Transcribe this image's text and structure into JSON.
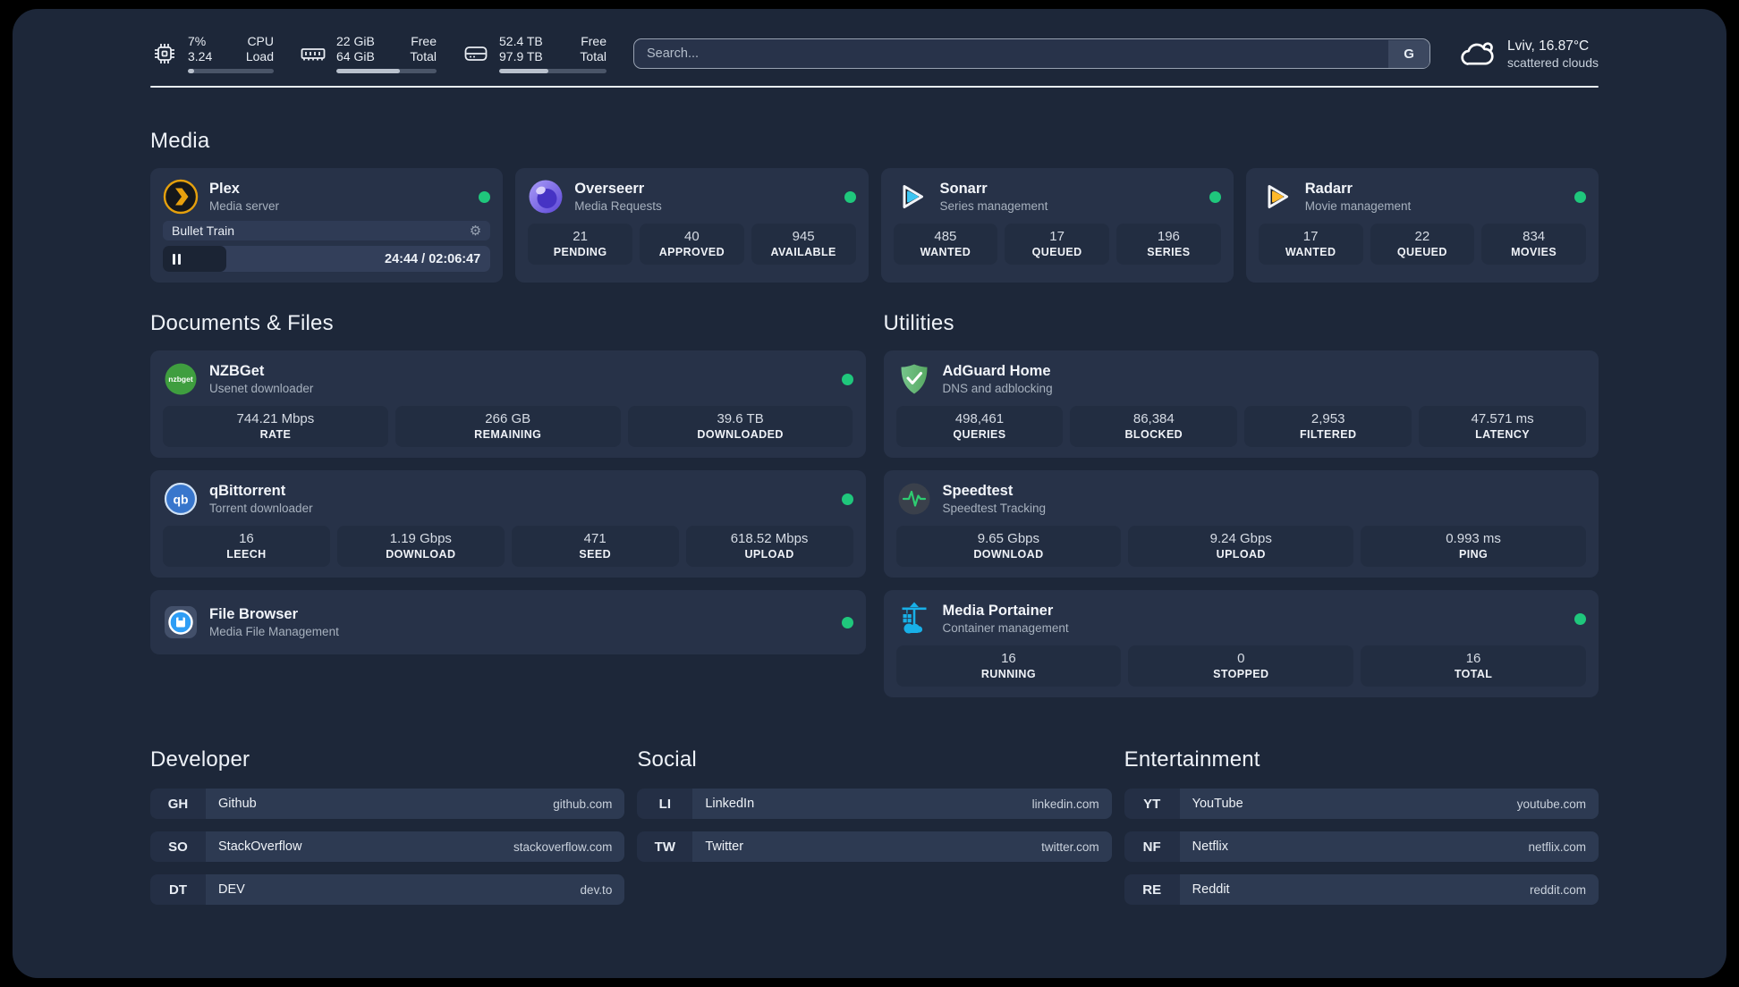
{
  "topbar": {
    "cpu": {
      "value1": "7%",
      "value2": "3.24",
      "label1": "CPU",
      "label2": "Load",
      "bar_style": "width:7%"
    },
    "memory": {
      "value1": "22 GiB",
      "value2": "64 GiB",
      "label1": "Free",
      "label2": "Total",
      "bar_style": "width:63%"
    },
    "disk": {
      "value1": "52.4 TB",
      "value2": "97.9 TB",
      "label1": "Free",
      "label2": "Total",
      "bar_style": "width:46%"
    },
    "search": {
      "placeholder": "Search...",
      "button_label": "G"
    },
    "weather": {
      "location": "Lviv, 16.87°C",
      "condition": "scattered clouds"
    }
  },
  "media": {
    "title": "Media",
    "plex": {
      "name": "Plex",
      "desc": "Media server",
      "now_playing": "Bullet Train",
      "time": "24:44 / 02:06:47",
      "progress_style": "width:19.5%"
    },
    "overseerr": {
      "name": "Overseerr",
      "desc": "Media Requests",
      "stats": [
        {
          "value": "21",
          "label": "PENDING"
        },
        {
          "value": "40",
          "label": "APPROVED"
        },
        {
          "value": "945",
          "label": "AVAILABLE"
        }
      ]
    },
    "sonarr": {
      "name": "Sonarr",
      "desc": "Series management",
      "stats": [
        {
          "value": "485",
          "label": "WANTED"
        },
        {
          "value": "17",
          "label": "QUEUED"
        },
        {
          "value": "196",
          "label": "SERIES"
        }
      ]
    },
    "radarr": {
      "name": "Radarr",
      "desc": "Movie management",
      "stats": [
        {
          "value": "17",
          "label": "WANTED"
        },
        {
          "value": "22",
          "label": "QUEUED"
        },
        {
          "value": "834",
          "label": "MOVIES"
        }
      ]
    }
  },
  "documents": {
    "title": "Documents & Files",
    "nzbget": {
      "name": "NZBGet",
      "desc": "Usenet downloader",
      "stats": [
        {
          "value": "744.21 Mbps",
          "label": "RATE"
        },
        {
          "value": "266 GB",
          "label": "REMAINING"
        },
        {
          "value": "39.6 TB",
          "label": "DOWNLOADED"
        }
      ]
    },
    "qbittorrent": {
      "name": "qBittorrent",
      "desc": "Torrent downloader",
      "stats": [
        {
          "value": "16",
          "label": "LEECH"
        },
        {
          "value": "1.19 Gbps",
          "label": "DOWNLOAD"
        },
        {
          "value": "471",
          "label": "SEED"
        },
        {
          "value": "618.52 Mbps",
          "label": "UPLOAD"
        }
      ]
    },
    "filebrowser": {
      "name": "File Browser",
      "desc": "Media File Management"
    }
  },
  "utilities": {
    "title": "Utilities",
    "adguard": {
      "name": "AdGuard Home",
      "desc": "DNS and adblocking",
      "stats": [
        {
          "value": "498,461",
          "label": "QUERIES"
        },
        {
          "value": "86,384",
          "label": "BLOCKED"
        },
        {
          "value": "2,953",
          "label": "FILTERED"
        },
        {
          "value": "47.571 ms",
          "label": "LATENCY"
        }
      ]
    },
    "speedtest": {
      "name": "Speedtest",
      "desc": "Speedtest Tracking",
      "stats": [
        {
          "value": "9.65 Gbps",
          "label": "DOWNLOAD"
        },
        {
          "value": "9.24 Gbps",
          "label": "UPLOAD"
        },
        {
          "value": "0.993 ms",
          "label": "PING"
        }
      ]
    },
    "portainer": {
      "name": "Media Portainer",
      "desc": "Container management",
      "stats": [
        {
          "value": "16",
          "label": "RUNNING"
        },
        {
          "value": "0",
          "label": "STOPPED"
        },
        {
          "value": "16",
          "label": "TOTAL"
        }
      ]
    }
  },
  "bookmarks": {
    "developer": {
      "title": "Developer",
      "links": [
        {
          "abbr": "GH",
          "name": "Github",
          "url": "github.com"
        },
        {
          "abbr": "SO",
          "name": "StackOverflow",
          "url": "stackoverflow.com"
        },
        {
          "abbr": "DT",
          "name": "DEV",
          "url": "dev.to"
        }
      ]
    },
    "social": {
      "title": "Social",
      "links": [
        {
          "abbr": "LI",
          "name": "LinkedIn",
          "url": "linkedin.com"
        },
        {
          "abbr": "TW",
          "name": "Twitter",
          "url": "twitter.com"
        }
      ]
    },
    "entertainment": {
      "title": "Entertainment",
      "links": [
        {
          "abbr": "YT",
          "name": "YouTube",
          "url": "youtube.com"
        },
        {
          "abbr": "NF",
          "name": "Netflix",
          "url": "netflix.com"
        },
        {
          "abbr": "RE",
          "name": "Reddit",
          "url": "reddit.com"
        }
      ]
    }
  },
  "colors": {
    "status_online": "#1fc77c",
    "page_bg": "#1d2739",
    "card_bg": "#273248"
  }
}
